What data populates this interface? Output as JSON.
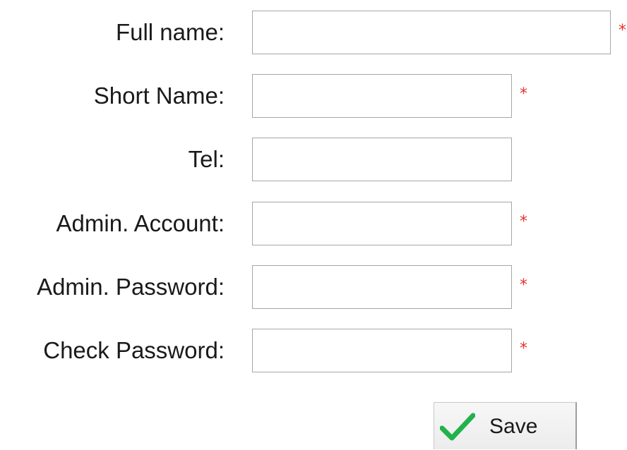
{
  "form": {
    "fields": [
      {
        "label": "Full name:",
        "value": "",
        "required_mark": "*"
      },
      {
        "label": "Short Name:",
        "value": "",
        "required_mark": "*"
      },
      {
        "label": "Tel:",
        "value": ""
      },
      {
        "label": "Admin. Account:",
        "value": "",
        "required_mark": "*"
      },
      {
        "label": "Admin. Password:",
        "value": "",
        "required_mark": "*"
      },
      {
        "label": "Check Password:",
        "value": "",
        "required_mark": "*"
      }
    ],
    "save_label": "Save",
    "save_icon": "check-icon",
    "colors": {
      "required": "#e8302f",
      "check": "#22b14c",
      "border": "#a6a6a6"
    }
  }
}
